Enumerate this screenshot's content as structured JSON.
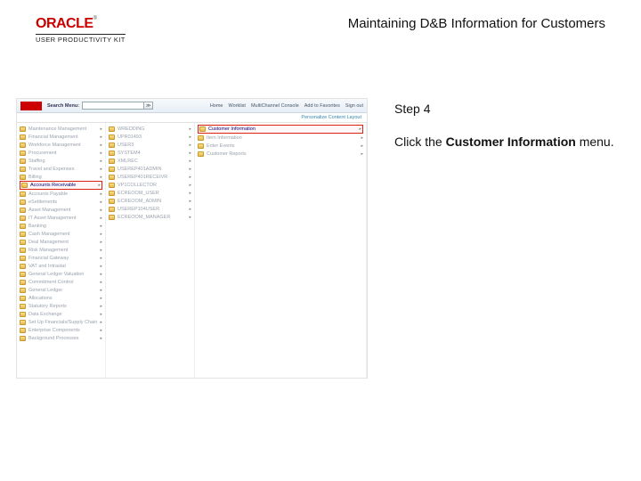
{
  "header": {
    "brand_name": "ORACLE",
    "brand_tm": "®",
    "brand_sub": "USER PRODUCTIVITY KIT",
    "doc_title": "Maintaining D&B Information for Customers"
  },
  "instruction": {
    "step": "Step 4",
    "prefix": "Click the ",
    "bold": "Customer Information",
    "suffix": " menu."
  },
  "app": {
    "search_label": "Search Menu:",
    "subbar": "Personalize Content  Layout",
    "topnav": [
      "Home",
      "Worklist",
      "MultiChannel Console",
      "Add to Favorites",
      "Sign out"
    ],
    "col1_items": [
      "Maintenance Management",
      "Financial Management",
      "Workforce Management",
      "Procurement",
      "Staffing",
      "Travel and Expenses",
      "Billing"
    ],
    "col1_hl": "Accounts Receivable",
    "col1_after": [
      "Accounts Payable",
      "eSettlements",
      "Asset Management",
      "IT Asset Management",
      "Banking",
      "Cash Management",
      "Deal Management",
      "Risk Management",
      "Financial Gateway",
      "VAT and Intrastat",
      "General Ledger Valuation",
      "Commitment Control",
      "General Ledger",
      "Allocations",
      "Statutory Reports",
      "Data Exchange",
      "Set Up Financials/Supply Chain",
      "Enterprise Components",
      "Background Processes"
    ],
    "col2_items": [
      "WREDDING",
      "UPR01493",
      "USER3",
      "SYSTEM4",
      "XMLREC",
      "USEREP401ADMIN",
      "USEREP401RECEIVR",
      "VP1COLLECTOR",
      "ECREOOM_USER",
      "ECREOOM_ADMIN",
      "USEREP104USER",
      "ECREOOM_MANAGER"
    ],
    "col3_hl": "Customer Information",
    "col3_items": [
      "Item Information",
      "Enter Events",
      "Customer Reports"
    ]
  }
}
